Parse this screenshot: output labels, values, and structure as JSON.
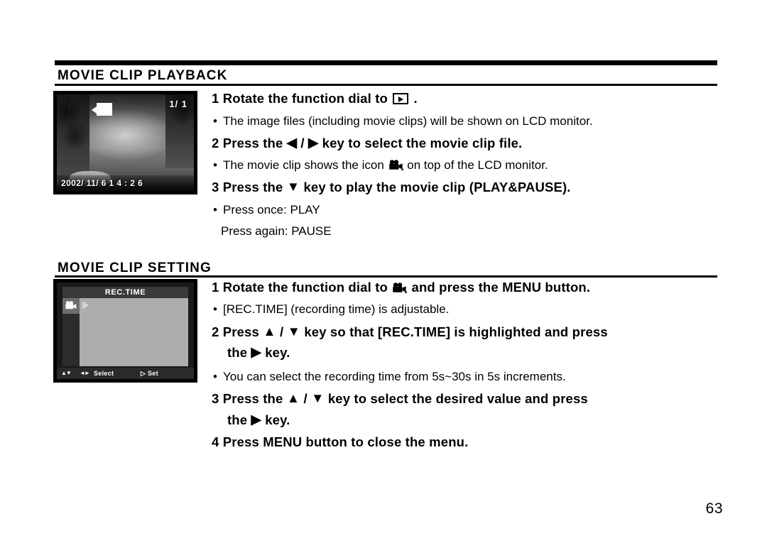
{
  "page": {
    "number": "63"
  },
  "sections": [
    {
      "heading": "MOVIE CLIP PLAYBACK",
      "lcd": {
        "type": "photo-preview",
        "counter": "1/  1",
        "datetime": "2002/ 11/   6    1 4 : 2 6",
        "overlay_icon": "movie-clip-badge-icon"
      },
      "steps": [
        {
          "number": "1",
          "text_before": "Rotate the function dial to",
          "icon": "playback-mode-icon",
          "text_after": "."
        },
        {
          "number": "2",
          "text_before": "Press the",
          "icon_left": "left-arrow-icon",
          "separator": "/",
          "icon_right": "right-arrow-icon",
          "text_after": "key to select the movie clip file."
        },
        {
          "number": "3",
          "text_before": "Press the",
          "icon": "down-arrow-icon",
          "text_after": "key to play the movie clip (PLAY&PAUSE)."
        }
      ],
      "bullets": [
        "The image files (including movie clips) will be shown on LCD monitor.",
        "The movie clip shows the icon",
        "Press once: PLAY"
      ],
      "bullet_movie_tail": "on top of the LCD monitor.",
      "subline": "Press again: PAUSE"
    },
    {
      "heading": "MOVIE CLIP SETTING",
      "lcd": {
        "type": "menu",
        "title": "REC.TIME",
        "tab_icon": "movie-camera-icon",
        "bottom_bar": {
          "updown_glyph": "▲▼",
          "leftright_glyph": "◄►",
          "select_label": "Select",
          "set_glyph": "▷",
          "set_label": "Set"
        }
      },
      "steps": [
        {
          "number": "1",
          "text_before": "Rotate the function dial to",
          "icon": "movie-camera-icon",
          "text_after": "and press the MENU button."
        },
        {
          "number": "2",
          "text_before": "Press",
          "icon_up": "up-arrow-icon",
          "separator": "/",
          "icon_down": "down-arrow-icon",
          "text_after": "key so that [REC.TIME] is highlighted and press",
          "continuation_before": "the",
          "continuation_icon": "right-arrow-icon",
          "continuation_after": "key."
        },
        {
          "number": "3",
          "text_before": "Press the",
          "icon_up": "up-arrow-icon",
          "separator": "/",
          "icon_down": "down-arrow-icon",
          "text_after": "key to select the desired value and press",
          "continuation_before": "the",
          "continuation_icon": "right-arrow-icon",
          "continuation_after": "key."
        },
        {
          "number": "4",
          "text_before": "Press MENU button to close the menu.",
          "icon": "",
          "text_after": ""
        }
      ],
      "bullets": [
        "[REC.TIME] (recording time) is adjustable.",
        "You can select the recording time from 5s~30s in 5s increments."
      ]
    }
  ]
}
